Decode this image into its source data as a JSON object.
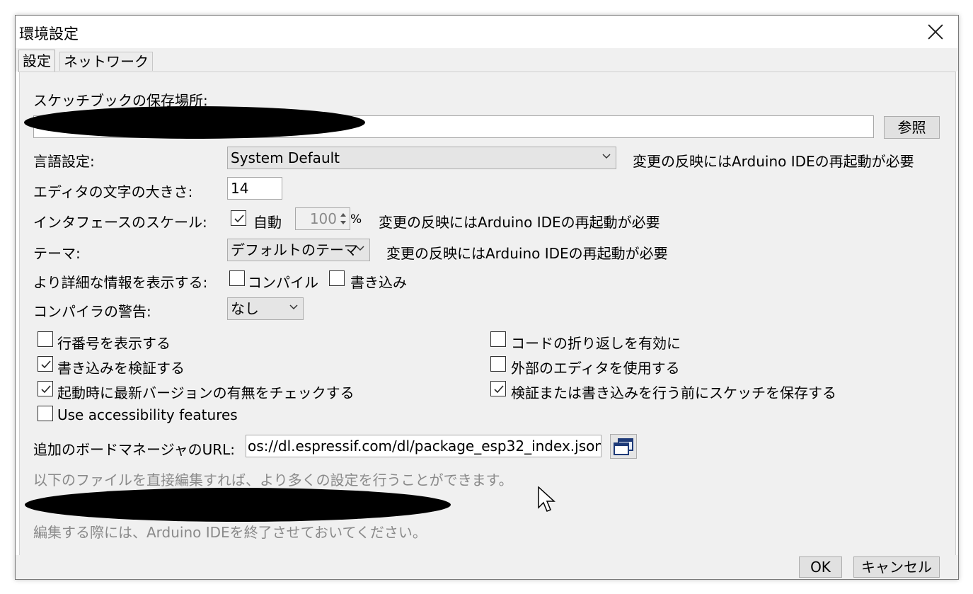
{
  "window": {
    "title": "環境設定"
  },
  "tabs": [
    {
      "label": "設定"
    },
    {
      "label": "ネットワーク"
    }
  ],
  "sketchbook": {
    "label": "スケッチブックの保存場所:",
    "path_value": "",
    "browse_label": "参照"
  },
  "language": {
    "label": "言語設定:",
    "selected": "System Default",
    "note": "変更の反映にはArduino IDEの再起動が必要"
  },
  "font_size": {
    "label": "エディタの文字の大きさ:",
    "value": "14"
  },
  "scale": {
    "label": "インタフェースのスケール:",
    "auto_label": "自動",
    "auto_checked": true,
    "value": "100",
    "unit": "%",
    "note": "変更の反映にはArduino IDEの再起動が必要"
  },
  "theme": {
    "label": "テーマ:",
    "selected": "デフォルトのテーマ",
    "note": "変更の反映にはArduino IDEの再起動が必要"
  },
  "verbose": {
    "label": "より詳細な情報を表示する:",
    "compile_label": "コンパイル",
    "compile_checked": false,
    "upload_label": "書き込み",
    "upload_checked": false
  },
  "warnings": {
    "label": "コンパイラの警告:",
    "selected": "なし"
  },
  "options": {
    "line_numbers": {
      "label": "行番号を表示する",
      "checked": false
    },
    "code_folding": {
      "label": "コードの折り返しを有効に",
      "checked": false
    },
    "verify_upload": {
      "label": "書き込みを検証する",
      "checked": true
    },
    "external_editor": {
      "label": "外部のエディタを使用する",
      "checked": false
    },
    "check_updates": {
      "label": "起動時に最新バージョンの有無をチェックする",
      "checked": true
    },
    "save_before": {
      "label": "検証または書き込みを行う前にスケッチを保存する",
      "checked": true
    },
    "accessibility": {
      "label": "Use accessibility features",
      "checked": false
    }
  },
  "board_urls": {
    "label": "追加のボードマネージャのURL:",
    "value": "os://dl.espressif.com/dl/package_esp32_index.json"
  },
  "info": {
    "line1": "以下のファイルを直接編集すれば、より多くの設定を行うことができます。",
    "line2": "編集する際には、Arduino IDEを終了させておいてください。"
  },
  "footer": {
    "ok_label": "OK",
    "cancel_label": "キャンセル"
  }
}
